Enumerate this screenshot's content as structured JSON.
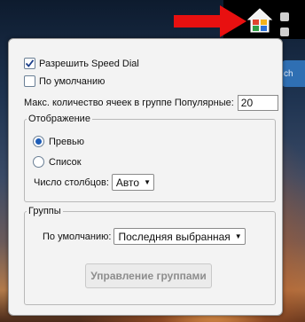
{
  "background": {
    "partial_search_text": "ch"
  },
  "toolbar": {
    "home_icon": "home-icon",
    "accent_colors": [
      "#e0452f",
      "#f3b21b",
      "#2f9e44",
      "#2b6fd6"
    ]
  },
  "dialog": {
    "enable_speed_dial": {
      "label": "Разрешить Speed Dial",
      "checked": true
    },
    "default": {
      "label": "По умолчанию",
      "checked": false
    },
    "max_cells": {
      "label": "Макс. количество ячеек в группе Популярные:",
      "value": "20"
    },
    "display": {
      "legend": "Отображение",
      "options": [
        {
          "label": "Превью",
          "selected": true
        },
        {
          "label": "Список",
          "selected": false
        }
      ],
      "columns_label": "Число столбцов:",
      "columns_value": "Авто"
    },
    "groups": {
      "legend": "Группы",
      "default_label": "По умолчанию:",
      "default_value": "Последняя выбранная",
      "manage_button": "Управление группами"
    }
  }
}
